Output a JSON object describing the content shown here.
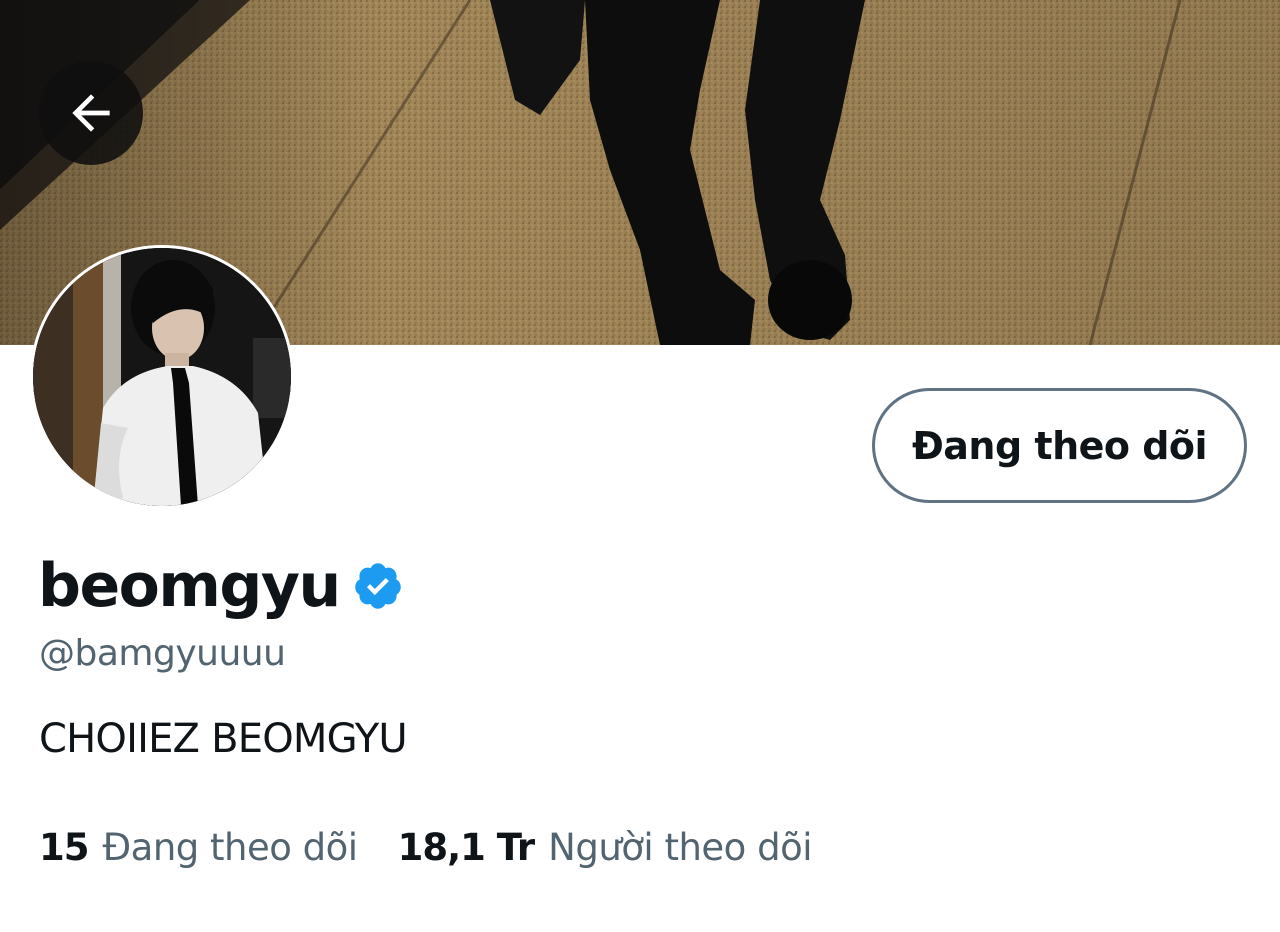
{
  "header": {
    "back_icon": "arrow-left-icon"
  },
  "profile": {
    "display_name": "beomgyu",
    "verified_icon": "verified-badge-icon",
    "handle": "@bamgyuuuu",
    "bio": "CHOIIEZ BEOMGYU",
    "follow_button_label": "Đang theo dõi"
  },
  "stats": {
    "following_count": "15",
    "following_label": "Đang theo dõi",
    "followers_count": "18,1 Tr",
    "followers_label": "Người theo dõi"
  },
  "colors": {
    "text_primary": "#0f1419",
    "text_secondary": "#536471",
    "verified_blue": "#1d9bf0",
    "button_border": "#5f7384"
  }
}
